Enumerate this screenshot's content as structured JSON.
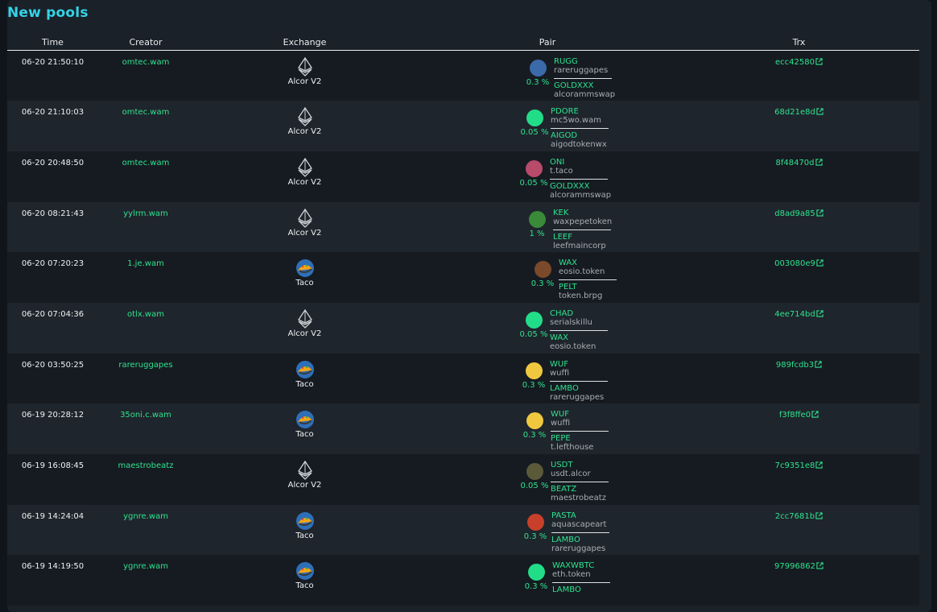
{
  "title": "New pools",
  "columns": [
    "Time",
    "Creator",
    "Exchange",
    "Pair",
    "Trx"
  ],
  "rows": [
    {
      "time": "06-20 21:50:10",
      "creator": "omtec.wam",
      "exchange": "Alcor V2",
      "exchange_icon": "alcor-icon",
      "token_icon": "rugg-token-icon",
      "fee": "0.3 %",
      "t1": "RUGG",
      "c1": "rareruggapes",
      "t2": "GOLDXXX",
      "c2": "alcorammswap",
      "trx": "ecc42580"
    },
    {
      "time": "06-20 21:10:03",
      "creator": "omtec.wam",
      "exchange": "Alcor V2",
      "exchange_icon": "alcor-icon",
      "token_icon": "pdore-token-icon",
      "fee": "0.05 %",
      "t1": "PDORE",
      "c1": "mc5wo.wam",
      "t2": "AIGOD",
      "c2": "aigodtokenwx",
      "trx": "68d21e8d"
    },
    {
      "time": "06-20 20:48:50",
      "creator": "omtec.wam",
      "exchange": "Alcor V2",
      "exchange_icon": "alcor-icon",
      "token_icon": "oni-token-icon",
      "fee": "0.05 %",
      "t1": "ONI",
      "c1": "t.taco",
      "t2": "GOLDXXX",
      "c2": "alcorammswap",
      "trx": "8f48470d"
    },
    {
      "time": "06-20 08:21:43",
      "creator": "yylrm.wam",
      "exchange": "Alcor V2",
      "exchange_icon": "alcor-icon",
      "token_icon": "kek-token-icon",
      "fee": "1 %",
      "t1": "KEK",
      "c1": "waxpepetoken",
      "t2": "LEEF",
      "c2": "leefmaincorp",
      "trx": "d8ad9a85"
    },
    {
      "time": "06-20 07:20:23",
      "creator": "1.je.wam",
      "exchange": "Taco",
      "exchange_icon": "taco-icon",
      "token_icon": "wax-token-icon",
      "fee": "0.3 %",
      "t1": "WAX",
      "c1": "eosio.token",
      "t2": "PELT",
      "c2": "token.brpg",
      "trx": "003080e9"
    },
    {
      "time": "06-20 07:04:36",
      "creator": "otlx.wam",
      "exchange": "Alcor V2",
      "exchange_icon": "alcor-icon",
      "token_icon": "chad-token-icon",
      "fee": "0.05 %",
      "t1": "CHAD",
      "c1": "serialskillu",
      "t2": "WAX",
      "c2": "eosio.token",
      "trx": "4ee714bd"
    },
    {
      "time": "06-20 03:50:25",
      "creator": "rareruggapes",
      "exchange": "Taco",
      "exchange_icon": "taco-icon",
      "token_icon": "wuf-token-icon",
      "fee": "0.3 %",
      "t1": "WUF",
      "c1": "wuffi",
      "t2": "LAMBO",
      "c2": "rareruggapes",
      "trx": "989fcdb3"
    },
    {
      "time": "06-19 20:28:12",
      "creator": "35oni.c.wam",
      "exchange": "Taco",
      "exchange_icon": "taco-icon",
      "token_icon": "wuf-token-icon",
      "fee": "0.3 %",
      "t1": "WUF",
      "c1": "wuffi",
      "t2": "PEPE",
      "c2": "t.lefthouse",
      "trx": "f3f8ffe0"
    },
    {
      "time": "06-19 16:08:45",
      "creator": "maestrobeatz",
      "exchange": "Alcor V2",
      "exchange_icon": "alcor-icon",
      "token_icon": "usdt-token-icon",
      "fee": "0.05 %",
      "t1": "USDT",
      "c1": "usdt.alcor",
      "t2": "BEATZ",
      "c2": "maestrobeatz",
      "trx": "7c9351e8"
    },
    {
      "time": "06-19 14:24:04",
      "creator": "ygnre.wam",
      "exchange": "Taco",
      "exchange_icon": "taco-icon",
      "token_icon": "pasta-token-icon",
      "fee": "0.3 %",
      "t1": "PASTA",
      "c1": "aquascapeart",
      "t2": "LAMBO",
      "c2": "rareruggapes",
      "trx": "2cc7681b"
    },
    {
      "time": "06-19 14:19:50",
      "creator": "ygnre.wam",
      "exchange": "Taco",
      "exchange_icon": "taco-icon",
      "token_icon": "waxwbtc-token-icon",
      "fee": "0.3 %",
      "t1": "WAXWBTC",
      "c1": "eth.token",
      "t2": "LAMBO",
      "c2": "",
      "trx": "97996862"
    }
  ],
  "colors": {
    "accent": "#2ee28f",
    "title": "#33d3e6",
    "panel": "#1b2128"
  }
}
